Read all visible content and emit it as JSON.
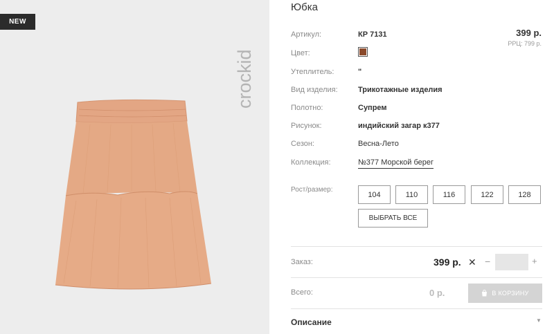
{
  "badge": "NEW",
  "logo_text": "crockid",
  "product": {
    "title": "Юбка",
    "price": "399 р.",
    "rrp": "РРЦ: 799 р.",
    "swatch_color": "#8b4a2b",
    "skirt_color": "#e2a783"
  },
  "specs": {
    "article": {
      "label": "Артикул:",
      "value": "КР 7131"
    },
    "color": {
      "label": "Цвет:"
    },
    "insulation": {
      "label": "Утеплитель:",
      "value": "\""
    },
    "type": {
      "label": "Вид изделия:",
      "value": "Трикотажные изделия"
    },
    "fabric": {
      "label": "Полотно:",
      "value": "Супрем"
    },
    "pattern": {
      "label": "Рисунок:",
      "value": "индийский загар к377"
    },
    "season": {
      "label": "Сезон:",
      "value": "Весна-Лето"
    },
    "collection": {
      "label": "Коллекция:",
      "value": "№377 Морской берег"
    }
  },
  "sizes": {
    "label": "Рост/размер:",
    "options": [
      "104",
      "110",
      "116",
      "122",
      "128"
    ],
    "select_all": "ВЫБРАТЬ ВСЕ"
  },
  "order": {
    "label": "Заказ:",
    "price": "399 р.",
    "times": "✕",
    "minus": "−",
    "plus": "+",
    "quantity": ""
  },
  "total": {
    "label": "Всего:",
    "price": "0 р.",
    "cart_label": "В КОРЗИНУ"
  },
  "description": {
    "title": "Описание",
    "caret": "▼"
  }
}
